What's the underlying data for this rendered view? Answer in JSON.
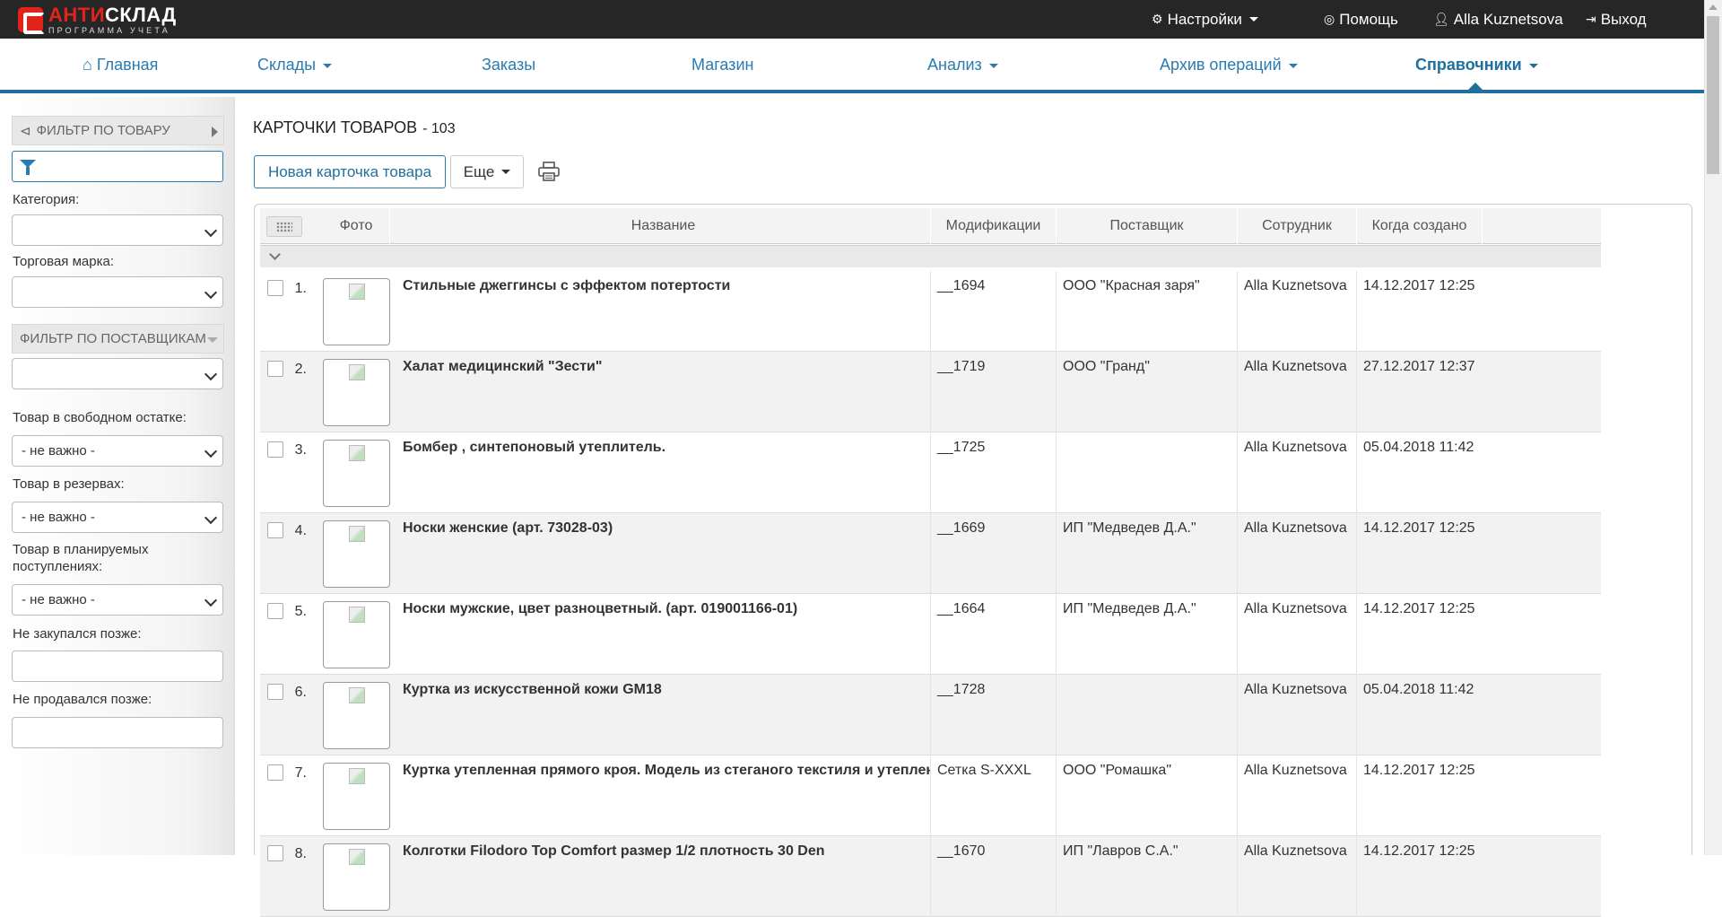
{
  "brand": {
    "name_red": "АНТИ",
    "name_white": "СКЛАД",
    "subtitle": "ПРОГРАММА УЧЕТА"
  },
  "topbar": {
    "settings": "Настройки",
    "help": "Помощь",
    "user": "Alla Kuznetsova",
    "logout": "Выход"
  },
  "mainnav": [
    {
      "label": "Главная"
    },
    {
      "label": "Склады"
    },
    {
      "label": "Заказы"
    },
    {
      "label": "Магазин"
    },
    {
      "label": "Анализ"
    },
    {
      "label": "Архив операций"
    },
    {
      "label": "Справочники",
      "active": true
    }
  ],
  "sidebar": {
    "product_filter": "ФИЛЬТР ПО ТОВАРУ",
    "category_label": "Категория:",
    "brand_label": "Торговая марка:",
    "supplier_filter": "ФИЛЬТР ПО ПОСТАВЩИКАМ",
    "free_stock_label": "Товар в свободном остатке:",
    "free_stock_value": "- не важно -",
    "reserve_label": "Товар в резервах:",
    "reserve_value": "- не важно -",
    "planned_label": "Товар в планируемых поступлениях:",
    "planned_value": "- не важно -",
    "not_bought_label": "Не закупался позже:",
    "not_sold_label": "Не продавался позже:"
  },
  "page": {
    "title": "КАРТОЧКИ ТОВАРОВ",
    "count": "- 103",
    "new_button": "Новая карточка товара",
    "more_button": "Еще"
  },
  "table": {
    "headers": {
      "photo": "Фото",
      "name": "Название",
      "mods": "Модификации",
      "supplier": "Поставщик",
      "employee": "Сотрудник",
      "created": "Когда создано"
    },
    "rows": [
      {
        "num": "1.",
        "name": "Стильные джеггинсы с эффектом потертости",
        "mods": "__1694",
        "supplier": "ООО \"Красная заря\"",
        "employee": "Alla Kuznetsova",
        "created": "14.12.2017 12:25"
      },
      {
        "num": "2.",
        "name": "Халат медицинский \"Зести\"",
        "mods": "__1719",
        "supplier": "ООО \"Гранд\"",
        "employee": "Alla Kuznetsova",
        "created": "27.12.2017 12:37"
      },
      {
        "num": "3.",
        "name": "Бомбер , синтепоновый утеплитель.",
        "mods": "__1725",
        "supplier": "",
        "employee": "Alla Kuznetsova",
        "created": "05.04.2018 11:42"
      },
      {
        "num": "4.",
        "name": "Носки женские (арт. 73028-03)",
        "mods": "__1669",
        "supplier": "ИП \"Медведев Д.А.\"",
        "employee": "Alla Kuznetsova",
        "created": "14.12.2017 12:25"
      },
      {
        "num": "5.",
        "name": "Носки мужские, цвет разноцветный. (арт. 019001166-01)",
        "mods": "__1664",
        "supplier": "ИП \"Медведев Д.А.\"",
        "employee": "Alla Kuznetsova",
        "created": "14.12.2017 12:25"
      },
      {
        "num": "6.",
        "name": "Куртка из искусственной кожи GM18",
        "mods": "__1728",
        "supplier": "",
        "employee": "Alla Kuznetsova",
        "created": "05.04.2018 11:42"
      },
      {
        "num": "7.",
        "name": "Куртка утепленная прямого кроя. Модель из стеганого текстиля и утеплена синтепоном",
        "mods": "Сетка S-XXXL",
        "supplier": "ООО \"Ромашка\"",
        "employee": "Alla Kuznetsova",
        "created": "14.12.2017 12:25"
      },
      {
        "num": "8.",
        "name": "Колготки Filodoro Top Comfort размер 1/2 плотность 30 Den",
        "mods": "__1670",
        "supplier": "ИП \"Лавров С.А.\"",
        "employee": "Alla Kuznetsova",
        "created": "14.12.2017 12:25"
      }
    ]
  }
}
